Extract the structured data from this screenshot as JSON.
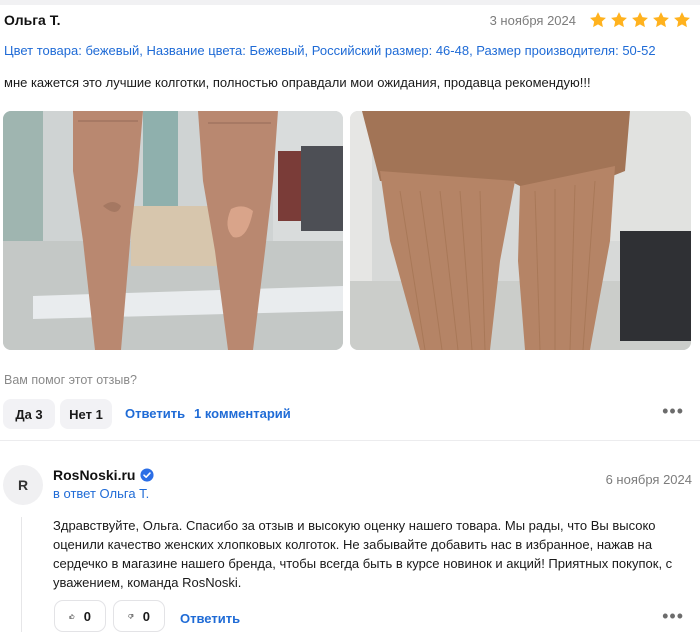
{
  "review": {
    "author": "Ольга Т.",
    "date": "3 ноября 2024",
    "rating": 5,
    "star_color": "#ffb21e",
    "product_info": "Цвет товара: бежевый, Название цвета: Бежевый, Российский размер: 46-48, Размер производителя: 50-52",
    "text": "мне кажется это лучшие колготки, полностью оправдали мои ожидания, продавца рекомендую!!!",
    "photos": [
      "review-photo-front",
      "review-photo-back"
    ]
  },
  "helpful": {
    "question": "Вам помог этот отзыв?",
    "yes_label": "Да 3",
    "no_label": "Нет 1",
    "reply_label": "Ответить",
    "comments_label": "1 комментарий",
    "more_label": "•••"
  },
  "seller_reply": {
    "avatar_letter": "R",
    "name": "RosNoski.ru",
    "verified_icon": "verified-check-icon",
    "in_reply_to": "в ответ Ольга Т.",
    "date": "6 ноября 2024",
    "text": "Здравствуйте, Ольга. Спасибо за отзыв и высокую оценку нашего товара. Мы рады, что Вы высоко оценили качество женских хлопковых колготок. Не забывайте добавить нас в избранное, нажав на сердечко в магазине нашего бренда, чтобы всегда быть в курсе новинок и акций! Приятных покупок, с уважением, команда RosNoski.",
    "likes": "0",
    "dislikes": "0",
    "reply_label": "Ответить",
    "more_label": "•••"
  },
  "colors": {
    "link": "#1f6bd6",
    "accent_verified": "#2b6ee6"
  }
}
